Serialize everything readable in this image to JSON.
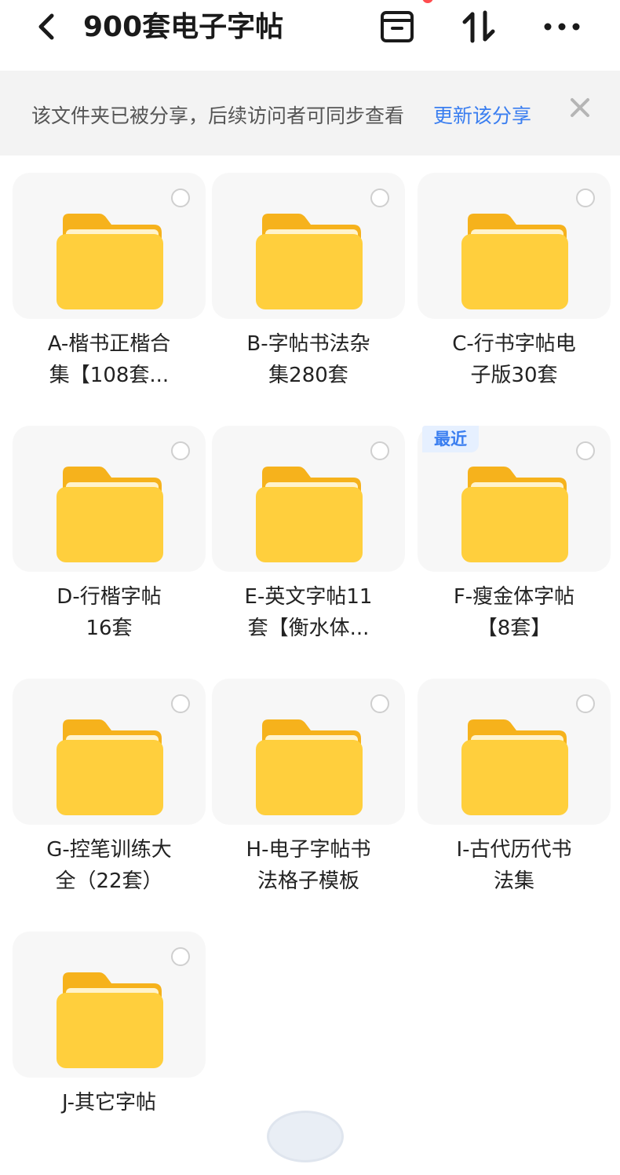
{
  "header": {
    "title": "900套电子字帖",
    "icons": [
      "back-arrow-icon",
      "archive-box-icon",
      "sort-icon",
      "more-icon"
    ],
    "accent": "#ff4d4f"
  },
  "banner": {
    "text": "该文件夹已被分享，后续访问者可同步查看",
    "link": "更新该分享",
    "link_color": "#3a7ef0",
    "close_icon": "close-icon"
  },
  "folders": [
    {
      "lines": [
        "A-楷书正楷合",
        "集【108套..."
      ]
    },
    {
      "lines": [
        "B-字帖书法杂",
        "集280套"
      ]
    },
    {
      "lines": [
        "C-行书字帖电",
        "子版30套"
      ]
    },
    {
      "lines": [
        "D-行楷字帖",
        "16套"
      ]
    },
    {
      "lines": [
        "E-英文字帖11",
        "套【衡水体..."
      ]
    },
    {
      "lines": [
        "F-瘦金体字帖",
        "【8套】"
      ],
      "badge": "最近"
    },
    {
      "lines": [
        "G-控笔训练大",
        "全（22套）"
      ]
    },
    {
      "lines": [
        "H-电子字帖书",
        "法格子模板"
      ]
    },
    {
      "lines": [
        "I-古代历代书",
        "法集"
      ]
    },
    {
      "lines": [
        "J-其它字帖"
      ]
    }
  ],
  "folder_color": "#ffcf3d"
}
